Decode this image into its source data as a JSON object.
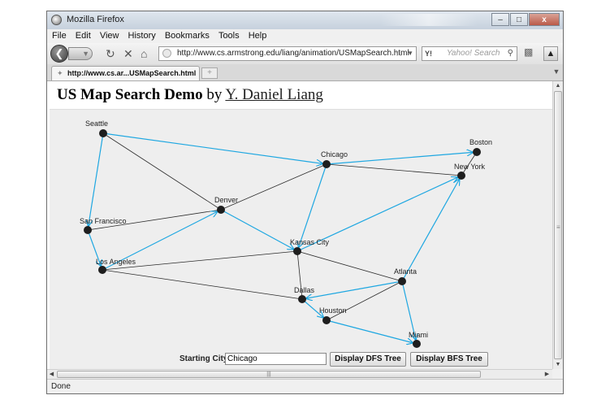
{
  "window": {
    "title": "Mozilla Firefox",
    "buttons": [
      "–",
      "□",
      "x"
    ]
  },
  "menu": [
    "File",
    "Edit",
    "View",
    "History",
    "Bookmarks",
    "Tools",
    "Help"
  ],
  "nav": {
    "url": "http://www.cs.armstrong.edu/liang/animation/USMapSearch.html",
    "search_engine": "Y!",
    "search_placeholder": "Yahoo! Search"
  },
  "tab": {
    "label": "http://www.cs.ar...USMapSearch.html",
    "new_tab": "+"
  },
  "page": {
    "heading_bold": "US Map Search Demo",
    "heading_by": "by",
    "heading_author": "Y. Daniel Liang"
  },
  "graph": {
    "cities": [
      {
        "name": "Seattle"
      },
      {
        "name": "San Francisco"
      },
      {
        "name": "Los Angeles"
      },
      {
        "name": "Denver"
      },
      {
        "name": "Kansas City"
      },
      {
        "name": "Chicago"
      },
      {
        "name": "Boston"
      },
      {
        "name": "New York"
      },
      {
        "name": "Atlanta"
      },
      {
        "name": "Miami"
      },
      {
        "name": "Dallas"
      },
      {
        "name": "Houston"
      }
    ],
    "edges": [
      {
        "from": "Seattle",
        "to": "Chicago",
        "tree": true
      },
      {
        "from": "Seattle",
        "to": "San Francisco",
        "tree": true
      },
      {
        "from": "Seattle",
        "to": "Denver",
        "tree": false
      },
      {
        "from": "San Francisco",
        "to": "Los Angeles",
        "tree": true
      },
      {
        "from": "San Francisco",
        "to": "Denver",
        "tree": false
      },
      {
        "from": "Los Angeles",
        "to": "Denver",
        "tree": true
      },
      {
        "from": "Los Angeles",
        "to": "Kansas City",
        "tree": false
      },
      {
        "from": "Los Angeles",
        "to": "Dallas",
        "tree": false
      },
      {
        "from": "Denver",
        "to": "Chicago",
        "tree": false
      },
      {
        "from": "Chicago",
        "to": "Kansas City",
        "tree": true
      },
      {
        "from": "Chicago",
        "to": "Boston",
        "tree": true
      },
      {
        "from": "Chicago",
        "to": "New York",
        "tree": false
      },
      {
        "from": "Boston",
        "to": "New York",
        "tree": false
      },
      {
        "from": "Denver",
        "to": "Kansas City",
        "tree": true
      },
      {
        "from": "Kansas City",
        "to": "New York",
        "tree": true
      },
      {
        "from": "Kansas City",
        "to": "Atlanta",
        "tree": false
      },
      {
        "from": "Kansas City",
        "to": "Dallas",
        "tree": false
      },
      {
        "from": "Atlanta",
        "to": "Dallas",
        "tree": true
      },
      {
        "from": "Atlanta",
        "to": "Houston",
        "tree": false
      },
      {
        "from": "Atlanta",
        "to": "New York",
        "tree": true
      },
      {
        "from": "Atlanta",
        "to": "Miami",
        "tree": true
      },
      {
        "from": "Dallas",
        "to": "Houston",
        "tree": true
      },
      {
        "from": "Houston",
        "to": "Miami",
        "tree": true
      }
    ],
    "tree_color": "#1ea7e1",
    "edge_color": "#2b2b2b"
  },
  "controls": {
    "starting_label": "Starting City:",
    "starting_value": "Chicago",
    "dfs_button": "Display DFS Tree",
    "bfs_button": "Display BFS Tree"
  },
  "status": "Done"
}
